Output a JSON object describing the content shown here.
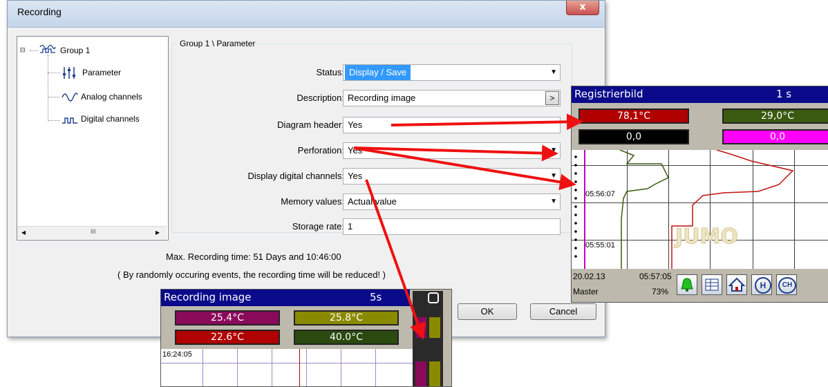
{
  "dialog": {
    "title": "Recording",
    "close_label": "x",
    "tree": {
      "root": "Group 1",
      "root_toggle": "⊟",
      "items": [
        "Parameter",
        "Analog channels",
        "Digital channels"
      ],
      "scroll_left": "◂",
      "scroll_right": "▸",
      "scroll_thumb": "III"
    },
    "group_title": "Group 1 \\ Parameter",
    "fields": [
      {
        "label": "Status:",
        "value": "Display / Save",
        "control": "dropdown"
      },
      {
        "label": "Description:",
        "value": "Recording image",
        "control": "text-with-button",
        "button": ">"
      },
      {
        "label": "Diagram header:",
        "value": "Yes",
        "control": "text"
      },
      {
        "label": "Perforation:",
        "value": "Yes",
        "control": "dropdown"
      },
      {
        "label": "Display digital channels:",
        "value": "Yes",
        "control": "dropdown"
      },
      {
        "label": "Memory values:",
        "value": "Actual value",
        "control": "dropdown"
      },
      {
        "label": "Storage rate:",
        "value": "1",
        "control": "text"
      }
    ],
    "max_recording": "Max. Recording time: 51 Days and 10:46:00",
    "note": "( By randomly occuring events, the recording time will be reduced! )",
    "ok_label": "OK",
    "cancel_label": "Cancel"
  },
  "device_de": {
    "title": "Registrierbild",
    "rate": "1 s",
    "values": [
      {
        "text": "78,1°C",
        "color": "#b00000"
      },
      {
        "text": "29,0°C",
        "color": "#3a5a10"
      },
      {
        "text": "0,0",
        "color": "#000000"
      },
      {
        "text": "0,0",
        "color": "#ff00ff"
      }
    ],
    "times": [
      "05:56:07",
      "05:55:01"
    ],
    "watermark": "JUMO",
    "status_date": "20.02.13",
    "status_time": "05:57:05",
    "status_user": "Master",
    "status_pct": "73%",
    "toolbar_icons": [
      "bell-icon",
      "table-icon",
      "home-icon",
      "history-icon",
      "channel-icon"
    ],
    "toolbar_glyphs": {
      "history": "H",
      "channel": "CH"
    }
  },
  "device_en": {
    "title": "Recording image",
    "rate": "5s",
    "values": [
      {
        "text": "25.4°C",
        "color": "#8a0a5a"
      },
      {
        "text": "25.8°C",
        "color": "#8a8a00"
      },
      {
        "text": "22.6°C",
        "color": "#b00000"
      },
      {
        "text": "40.0°C",
        "color": "#2a4a10"
      }
    ],
    "time": "16:24:05"
  }
}
